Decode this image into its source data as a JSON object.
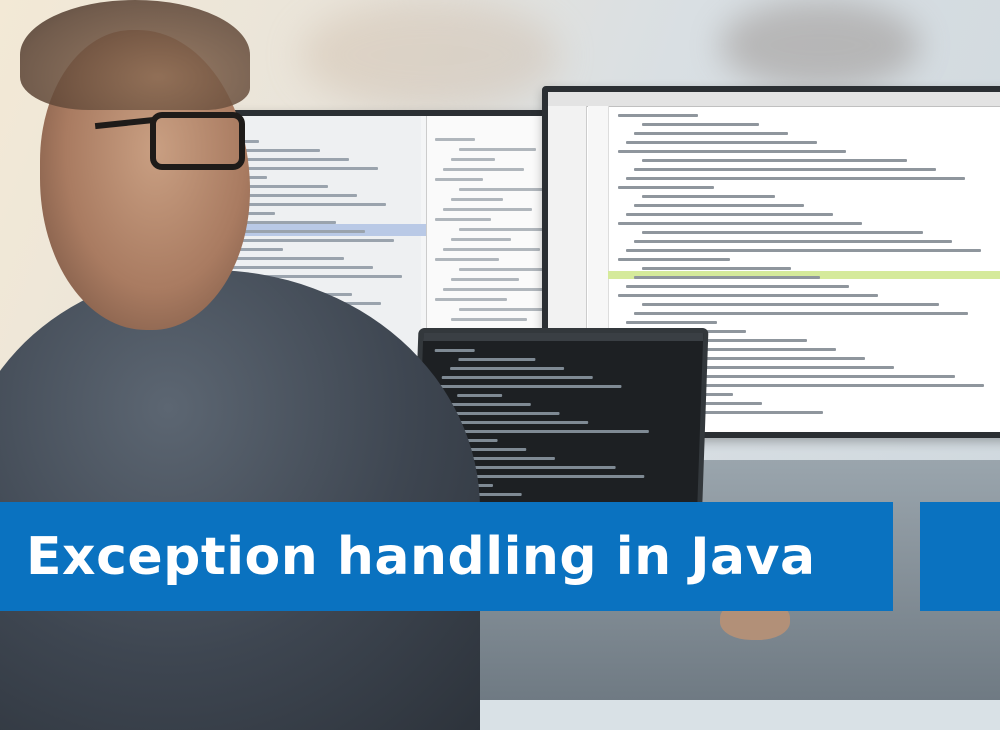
{
  "banner": {
    "title": "Exception handling in Java"
  },
  "colors": {
    "banner_blue": "#0a72c0",
    "banner_text": "#ffffff",
    "highlight_green": "#d5ea9b"
  }
}
